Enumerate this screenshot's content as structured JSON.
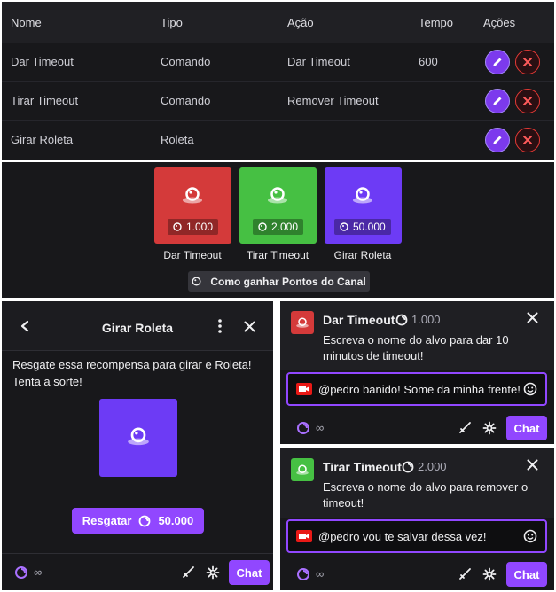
{
  "table": {
    "headers": [
      "Nome",
      "Tipo",
      "Ação",
      "Tempo",
      "Ações"
    ],
    "rows": [
      {
        "name": "Dar Timeout",
        "type": "Comando",
        "action": "Dar Timeout",
        "time": "600"
      },
      {
        "name": "Tirar Timeout",
        "type": "Comando",
        "action": "Remover Timeout",
        "time": ""
      },
      {
        "name": "Girar Roleta",
        "type": "Roleta",
        "action": "",
        "time": ""
      }
    ]
  },
  "rewards": {
    "cards": [
      {
        "title": "Dar Timeout",
        "cost": "1.000",
        "color": "#d43a3a"
      },
      {
        "title": "Tirar Timeout",
        "cost": "2.000",
        "color": "#46c043"
      },
      {
        "title": "Girar Roleta",
        "cost": "50.000",
        "color": "#6d3bf5"
      }
    ],
    "how_to_earn": "Como ganhar Pontos do Canal"
  },
  "roleta_panel": {
    "title": "Girar Roleta",
    "description": "Resgate essa recompensa para girar e Roleta! Tenta a sorte!",
    "redeem_label": "Resgatar",
    "redeem_cost": "50.000",
    "points": "∞",
    "chat_label": "Chat"
  },
  "chat_panels": [
    {
      "title": "Dar Timeout",
      "cost": "1.000",
      "description": "Escreva o nome do alvo para dar 10 minutos de timeout!",
      "message": "@pedro banido! Some da minha frente!",
      "points": "∞",
      "chat_label": "Chat",
      "icon_color": "#d43a3a"
    },
    {
      "title": "Tirar Timeout",
      "cost": "2.000",
      "description": "Escreva o nome do alvo para remover o timeout!",
      "message": "@pedro vou te salvar dessa vez!",
      "points": "∞",
      "chat_label": "Chat",
      "icon_color": "#46c043"
    }
  ],
  "colors": {
    "accent": "#9147ff",
    "background": "#18181b",
    "danger": "#e53935"
  }
}
